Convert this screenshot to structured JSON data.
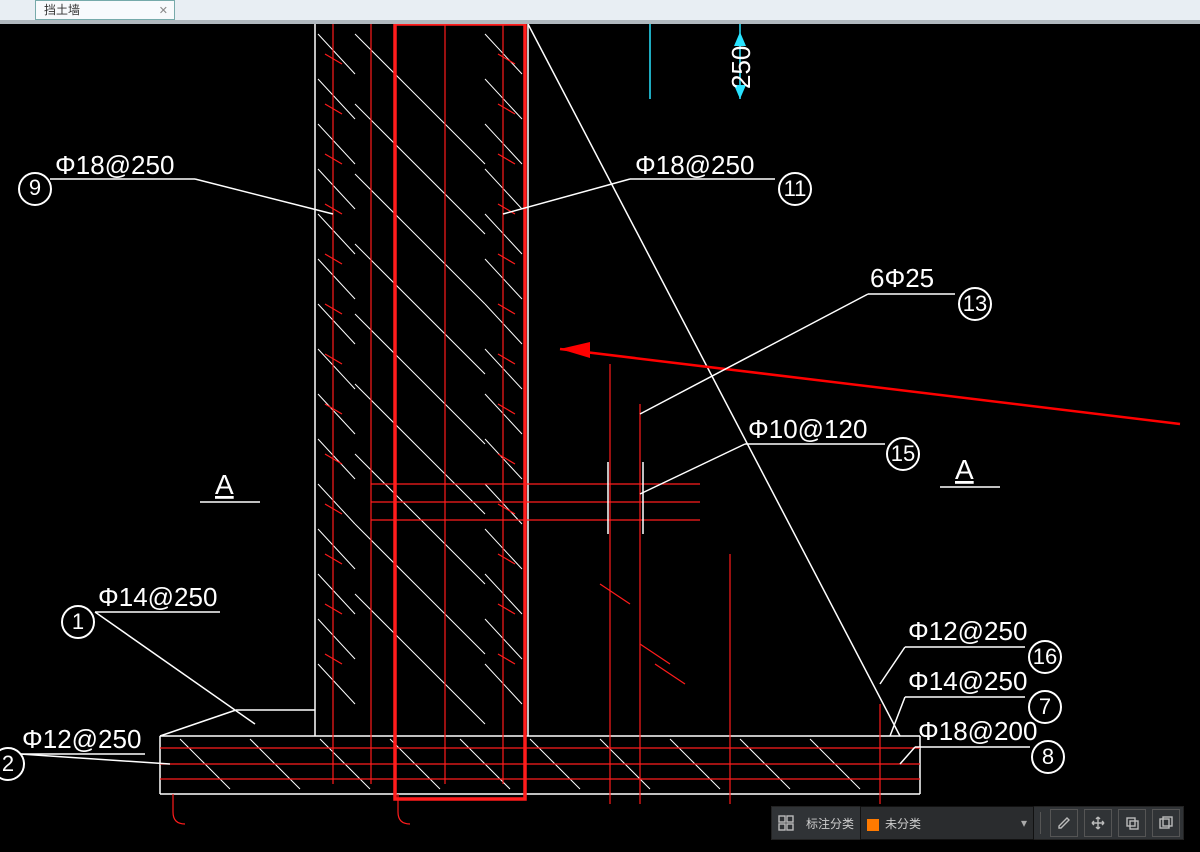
{
  "tab": {
    "title": "挡土墙"
  },
  "dimensions": {
    "top_vertical": "250"
  },
  "labels": {
    "nine": {
      "num": "9",
      "text": "Φ18@250"
    },
    "eleven": {
      "num": "11",
      "text": "Φ18@250"
    },
    "thirteen": {
      "num": "13",
      "text": "6Φ25"
    },
    "fifteen": {
      "num": "15",
      "text": "Φ10@120"
    },
    "one": {
      "num": "1",
      "text": "Φ14@250"
    },
    "two": {
      "num": "2",
      "text": "Φ12@250"
    },
    "sixteen": {
      "num": "16",
      "text": "Φ12@250"
    },
    "seven": {
      "num": "7",
      "text": "Φ14@250"
    },
    "eight": {
      "num": "8",
      "text": "Φ18@200"
    }
  },
  "section_marks": {
    "left": "A",
    "right": "A"
  },
  "toolbar": {
    "label": "标注分类",
    "select_value": "未分类"
  }
}
